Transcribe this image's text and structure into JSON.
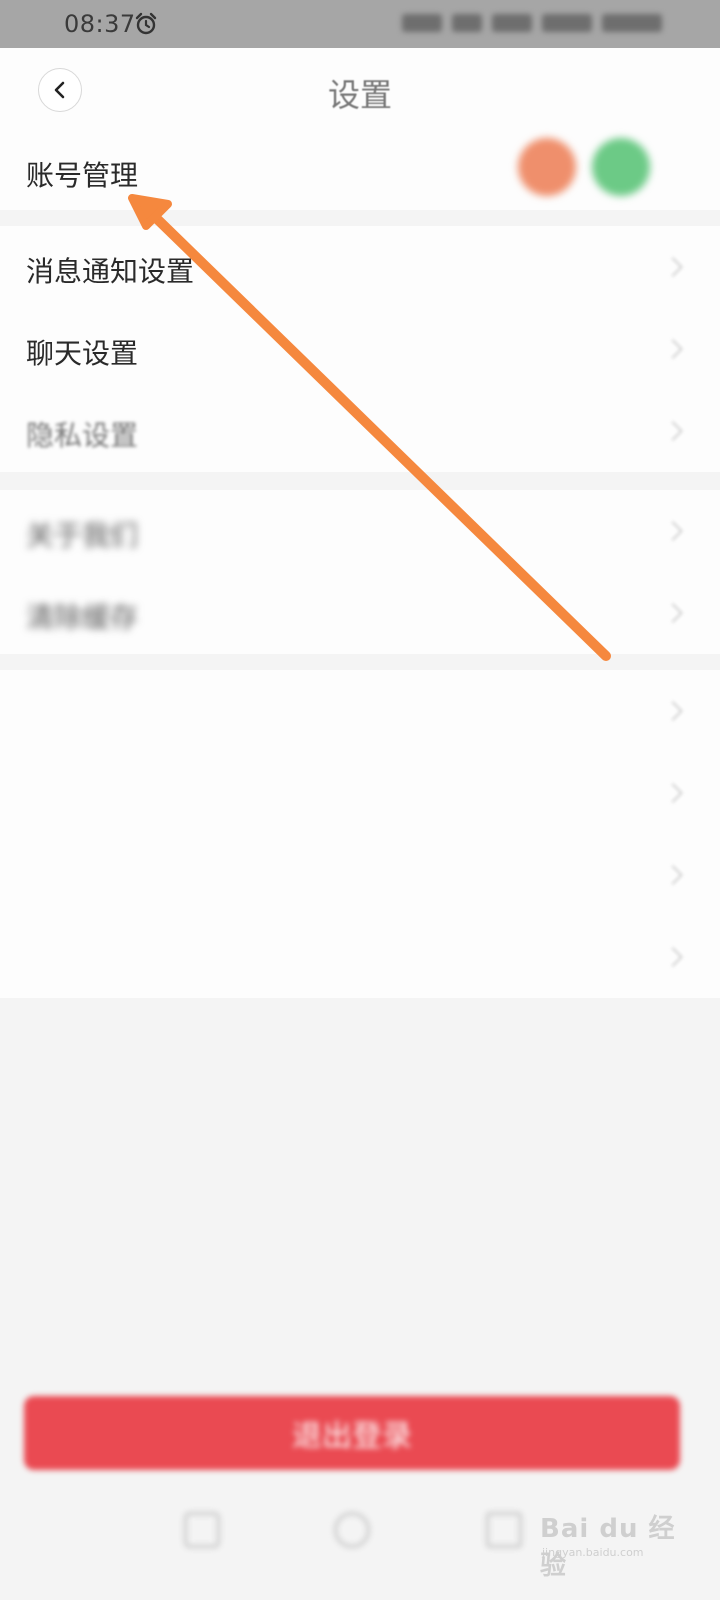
{
  "status_bar": {
    "time": "08:37",
    "alarm_icon": "alarm-clock-icon"
  },
  "header": {
    "title": "设置",
    "back_icon": "chevron-left-icon"
  },
  "sections": {
    "account": {
      "label": "账号管理"
    },
    "group1": [
      {
        "label": "消息通知设置"
      },
      {
        "label": "聊天设置"
      },
      {
        "label": "隐私设置"
      }
    ],
    "group2": [
      {
        "label": "关于我们"
      },
      {
        "label": "清除缓存"
      }
    ],
    "group3": [
      {
        "label": ""
      },
      {
        "label": ""
      },
      {
        "label": ""
      },
      {
        "label": ""
      }
    ]
  },
  "logout": {
    "label": "退出登录"
  },
  "annotation": {
    "arrow_color": "#F5883E"
  },
  "watermark": {
    "text": "Bai du 经验",
    "sub": "jingyan.baidu.com"
  },
  "colors": {
    "logout_red": "#EA4A52",
    "avatar_orange": "#EF8F6C",
    "avatar_green": "#6CCA86"
  }
}
